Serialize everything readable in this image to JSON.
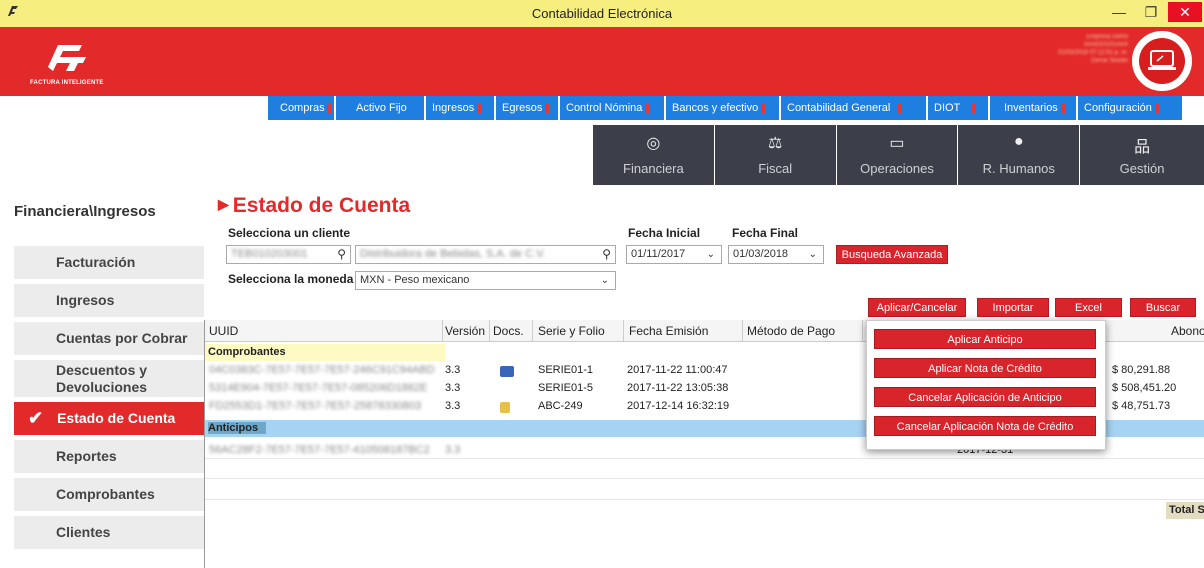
{
  "window": {
    "title": "Contabilidad Electrónica",
    "minimize": "—",
    "maximize": "❐",
    "close": "✕"
  },
  "brand": {
    "logo_text": "FACTURA INTELIGENTE",
    "company_lines": [
      "Empresa Demo",
      "AAA010101AAA",
      "01/03/2018 07:12:51 p. m.",
      "Cerrar Sesión"
    ]
  },
  "menu": [
    {
      "label": "Compras"
    },
    {
      "label": "Activo Fijo"
    },
    {
      "label": "Ingresos"
    },
    {
      "label": "Egresos"
    },
    {
      "label": "Control Nómina"
    },
    {
      "label": "Bancos y efectivo"
    },
    {
      "label": "Contabilidad General"
    },
    {
      "label": "DIOT"
    },
    {
      "label": "Inventarios"
    },
    {
      "label": "Configuración"
    }
  ],
  "modules": [
    {
      "label": "Financiera",
      "icon": "coins-icon"
    },
    {
      "label": "Fiscal",
      "icon": "scale-icon"
    },
    {
      "label": "Operaciones",
      "icon": "kiosk-icon"
    },
    {
      "label": "R. Humanos",
      "icon": "person-icon"
    },
    {
      "label": "Gestión",
      "icon": "org-chart-icon"
    }
  ],
  "breadcrumb": "Financiera\\Ingresos",
  "sidebar": [
    {
      "label": "Facturación"
    },
    {
      "label": "Ingresos"
    },
    {
      "label": "Cuentas por Cobrar"
    },
    {
      "label": "Descuentos y Devoluciones"
    },
    {
      "label": "Estado de Cuenta",
      "active": true
    },
    {
      "label": "Reportes"
    },
    {
      "label": "Comprobantes"
    },
    {
      "label": "Clientes"
    }
  ],
  "page": {
    "title": "Estado de Cuenta",
    "client_label": "Selecciona un cliente",
    "client_rfc": "TEB010203001",
    "client_name": "Distribuidora de Bebidas, S.A. de C.V.",
    "fecha_inicial_label": "Fecha Inicial",
    "fecha_inicial": "01/11/2017",
    "fecha_final_label": "Fecha Final",
    "fecha_final": "01/03/2018",
    "advanced_search": "Busqueda Avanzada",
    "currency_label": "Selecciona la moneda",
    "currency": "MXN - Peso mexicano",
    "buttons": {
      "apply_cancel": "Aplicar/Cancelar",
      "import": "Importar",
      "excel": "Excel",
      "search": "Buscar"
    }
  },
  "grid": {
    "columns": [
      "UUID",
      "Versión",
      "Docs.",
      "Serie y Folio",
      "Fecha Emisión",
      "Método de Pago",
      "Abono"
    ],
    "group_comprobantes": "Comprobantes",
    "group_anticipos": "Anticipos",
    "rows": [
      {
        "uuid": "04C0383C-7E57-7E57-7E57-246C91C94ABD",
        "version": "3.3",
        "folio": "SERIE01-1",
        "fecha": "2017-11-22 11:00:47",
        "monto": "$ 80,291.88"
      },
      {
        "uuid": "5314E904-7E57-7E57-7E57-085206D1882E",
        "version": "3.3",
        "folio": "SERIE01-5",
        "fecha": "2017-11-22 13:05:38",
        "monto": "$ 508,451.20"
      },
      {
        "uuid": "FD2553D1-7E57-7E57-7E57-25878330803",
        "version": "3.3",
        "folio": "ABC-249",
        "fecha": "2017-12-14 16:32:19",
        "monto": "$ 48,751.73"
      }
    ],
    "anticipo_row": {
      "uuid": "56AC28F2-7E57-7E57-7E57-410508187BC2",
      "version": "3.3",
      "fecha": "2017-12-31"
    },
    "total_label": "Total S"
  },
  "dropdown": [
    "Aplicar Anticipo",
    "Aplicar Nota de Crédito",
    "Cancelar Aplicación de Anticipo",
    "Cancelar Aplicación Nota de Crédito"
  ]
}
